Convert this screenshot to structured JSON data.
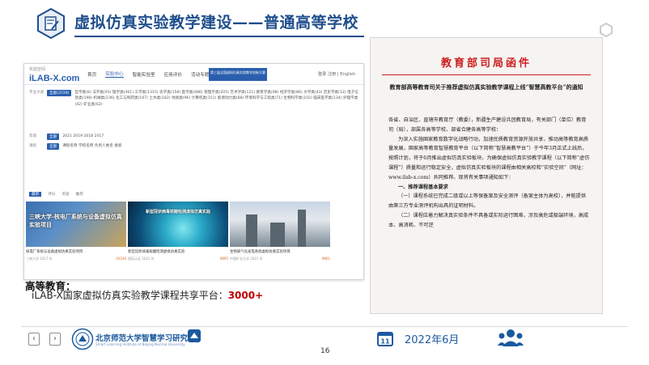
{
  "header": {
    "title": "虚拟仿真实验教学建设——普通高等学校",
    "accent_color": "#1f4e8c",
    "icon": "edit-document-icon"
  },
  "screenshot": {
    "logo": "iLAB-X.com",
    "logo_sub": "实验空间",
    "nav": [
      "首页",
      "实验中心",
      "智能实验室",
      "应用评价",
      "活动专题"
    ],
    "banner_text": "第三届全国虚拟仿真实验教学创新大赛",
    "login": "登录 注册 | English",
    "filters": [
      {
        "label": "专业大类",
        "chip": "全部(3729)",
        "options": "哲学类(8)  法学类(91)  理学类(461)  工学类(1315)  农学类(158)  医学类(486)  管理学类(205)  艺术学类(121)  教育学类(98)  经济学类(86)  文学类(43)  历史学类(12)  电子信息类(198)  机械类(236)  化工与制药类(167)  土木类(182)  地质类(96)  计算机类(151)  能源动力类(88)  环境科学与工程类(71)  生物科学类(102)  临床医学类(134)  护理学类(42)  矿业类(62)"
      },
      {
        "label": "年级",
        "chip": "全部",
        "options": "2021  2019  2018  2017"
      },
      {
        "label": "课程",
        "chip": "全部",
        "options": "课程名称  学校名称  负责人姓名  搜索"
      }
    ],
    "tabs": [
      "最新",
      "评分",
      "浏览",
      "推荐"
    ],
    "cards": [
      {
        "cap": "三峡大学-核电厂系统与设备虚拟仿真实验项目",
        "title": "核电厂系统与设备虚拟仿真实验项目",
        "meta_left": "三峡大学  2017 年",
        "meta_right": "10240"
      },
      {
        "cap": "新型冠状病毒核酸检测虚拟仿真实验",
        "title": "新型冠状病毒核酸检测虚拟仿真实验",
        "meta_left": "国际认证  2021 年",
        "meta_right": "9895"
      },
      {
        "cap": "",
        "title": "生物质气化发电系统虚拟仿真实验项目",
        "meta_left": "中国矿业大学  2021 年",
        "meta_right": "9801"
      }
    ]
  },
  "overlay": {
    "label": "高等教育：",
    "line_prefix": "iLAB-X国家虚拟仿真实验教学课程共享平台：",
    "line_value": "3000+",
    "value_color": "#c00000"
  },
  "document": {
    "head": "教育部司局函件",
    "subtitle": "教育部高等教育司关于推荐虚拟仿真实验教学课程上线“智慧高教平台”的通知",
    "salutation": "各省、自治区、直辖市教育厅（教委），新疆生产建设兵团教育局，有关部门（单位）教育司（局），部属各高等学校、部省合建各高等学校：",
    "para1": "为深入实施国家教育数字化战略行动，加速优质教育资源开放共享，推动高等教育高质量发展，国家高等教育智慧教育平台（以下简称“智慧高教平台”）于今年3月正式上线后，按照计划，将于6月推出虚拟仿真实验板块，为确保虚拟仿真实验教学课程（以下简称“虚仿课程”）质量和运行稳定安全，虚拟仿真实验板块的课程由相关高校和“实验空间”（网址：www.ilab-x.com）共同推荐。现将有关事项通知如下：",
    "heading1": "一、推荐课程基本要求",
    "para2": "（一）课程系统已完成二级或以上等保备案及安全测评（备案主体为高校），并能提供由第三方专业测评机构出具的证明材料。",
    "para3": "（二）课程应着力解决真实验条件不具备或实际运行困难，涉及高危或极端环境，高成本、高消耗、不可逆"
  },
  "footer": {
    "prev": "‹",
    "next": "›",
    "org_name": "北京师范大学智慧学习研究院",
    "org_sub": "Smart Learning Institute of Beijing Normal University",
    "page": "16",
    "date": "2022年6月",
    "calendar_day": "11"
  }
}
